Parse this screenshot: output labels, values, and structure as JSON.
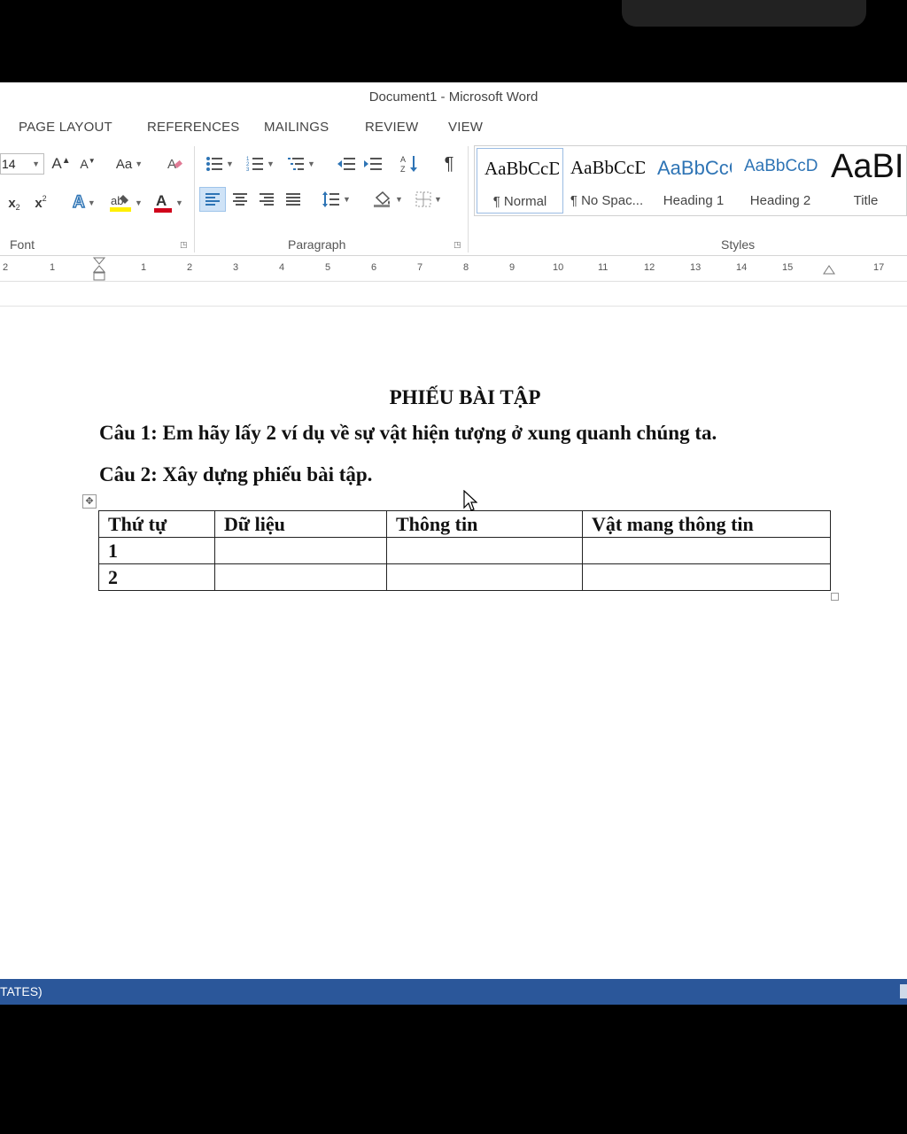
{
  "window": {
    "title": "Document1 - Microsoft Word"
  },
  "tabs": [
    "PAGE LAYOUT",
    "REFERENCES",
    "MAILINGS",
    "REVIEW",
    "VIEW"
  ],
  "ribbon": {
    "font_size": "14",
    "groups": {
      "font": "Font",
      "paragraph": "Paragraph",
      "styles": "Styles"
    },
    "styles": [
      {
        "sample": "AaBbCcDc",
        "name": "¶ Normal",
        "color": "#111111"
      },
      {
        "sample": "AaBbCcDc",
        "name": "¶ No Spac...",
        "color": "#111111"
      },
      {
        "sample": "AaBbCcC",
        "name": "Heading 1",
        "color": "#2e74b5"
      },
      {
        "sample": "AaBbCcDc",
        "name": "Heading 2",
        "color": "#2e74b5"
      },
      {
        "sample": "AaBI",
        "name": "Title",
        "color": "#111111"
      }
    ]
  },
  "ruler": {
    "numbers": [
      "2",
      "1",
      "1",
      "2",
      "3",
      "4",
      "5",
      "6",
      "7",
      "8",
      "9",
      "10",
      "11",
      "12",
      "13",
      "14",
      "15",
      "17"
    ]
  },
  "document": {
    "heading": "PHIẾU BÀI TẬP",
    "question1": "Câu 1: Em hãy lấy 2 ví dụ về sự vật hiện tượng ở xung quanh chúng ta.",
    "question2": "Câu 2: Xây dựng phiếu bài tập.",
    "table": {
      "headers": [
        "Thứ tự",
        "Dữ liệu",
        "Thông tin",
        "Vật mang thông tin"
      ],
      "rows": [
        [
          "1",
          "",
          "",
          ""
        ],
        [
          "2",
          "",
          "",
          ""
        ]
      ]
    }
  },
  "status": {
    "text": "TATES)"
  },
  "colors": {
    "statusbar": "#2b579a",
    "accent_blue": "#2e74b5"
  }
}
